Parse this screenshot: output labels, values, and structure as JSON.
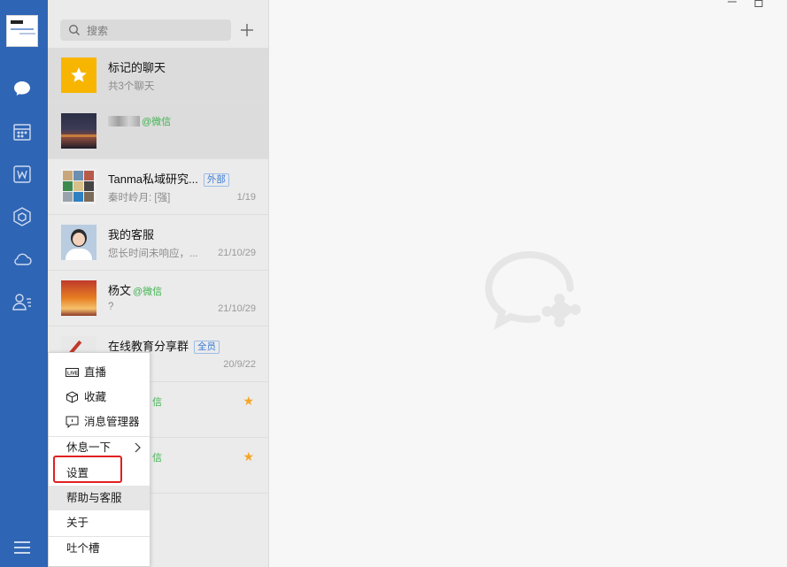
{
  "search": {
    "placeholder": "搜索"
  },
  "chats": [
    {
      "name": "标记的聊天",
      "sub": "共3个聊天",
      "date": "",
      "tag": "",
      "wx": ""
    },
    {
      "name": "",
      "sub": "",
      "date": "",
      "tag": "",
      "wx": "@微信"
    },
    {
      "name": "Tanma私域研究...",
      "sub": "秦时岭月: [强]",
      "date": "1/19",
      "tag": "外部",
      "wx": ""
    },
    {
      "name": "我的客服",
      "sub": "您长时间未响应，...",
      "date": "21/10/29",
      "tag": "",
      "wx": ""
    },
    {
      "name": "杨文",
      "sub": "?",
      "date": "21/10/29",
      "tag": "",
      "wx": "@微信"
    },
    {
      "name": "在线教育分享群",
      "sub": "",
      "date": "20/9/22",
      "tag": "全员",
      "wx": ""
    },
    {
      "name": "",
      "sub": "",
      "date": "",
      "tag": "",
      "wx": "信",
      "starred": true
    },
    {
      "name": "",
      "sub": "",
      "date": "",
      "tag": "",
      "wx": "信",
      "starred": true
    }
  ],
  "menu": {
    "live": "直播",
    "favorites": "收藏",
    "message_manager": "消息管理器",
    "take_break": "休息一下",
    "settings": "设置",
    "help": "帮助与客服",
    "about": "关于",
    "feedback": "吐个槽"
  },
  "colors": {
    "rail": "#2f65b5",
    "star": "#f5a623",
    "wechat_green": "#3fb34f",
    "tag_blue": "#3a7bd5",
    "highlight_red": "#e02020"
  }
}
